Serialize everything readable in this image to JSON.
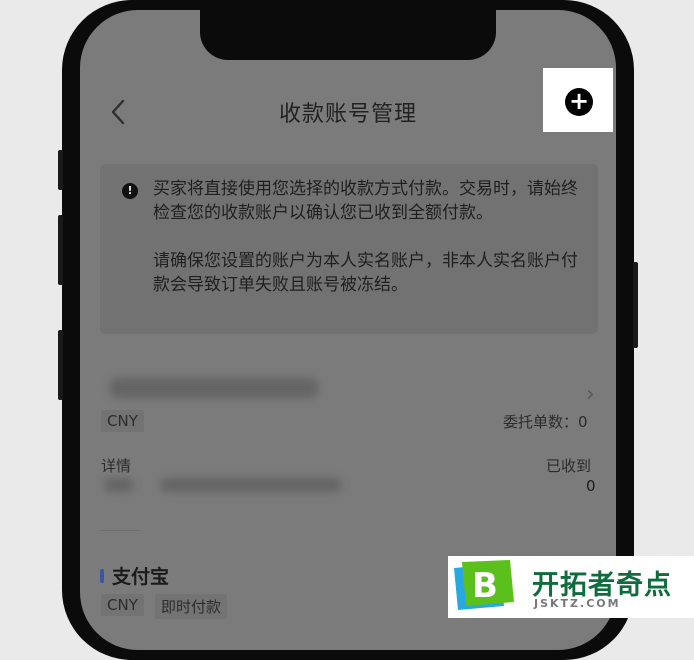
{
  "header": {
    "title": "收款账号管理",
    "back_icon": "chevron-left-icon",
    "add_icon": "plus-circle-icon"
  },
  "notice": {
    "icon": "info-icon",
    "paragraph1": "买家将直接使用您选择的收款方式付款。交易时，请始终检查您的收款账户以确认您已收到全额付款。",
    "paragraph2": "请确保您设置的账户为本人实名账户，非本人实名账户付款会导致订单失败且账号被冻结。"
  },
  "account_card": {
    "currency": "CNY",
    "delegated_label": "委托单数：",
    "delegated_count": "0",
    "details_label": "详情",
    "received_label": "已收到",
    "received_value": "0"
  },
  "payment_method": {
    "name": "支付宝",
    "currency": "CNY",
    "type": "即时付款",
    "accent_color": "#3856a6"
  },
  "watermark": {
    "name": "开拓者奇点",
    "url": "JSKTZ.COM"
  }
}
